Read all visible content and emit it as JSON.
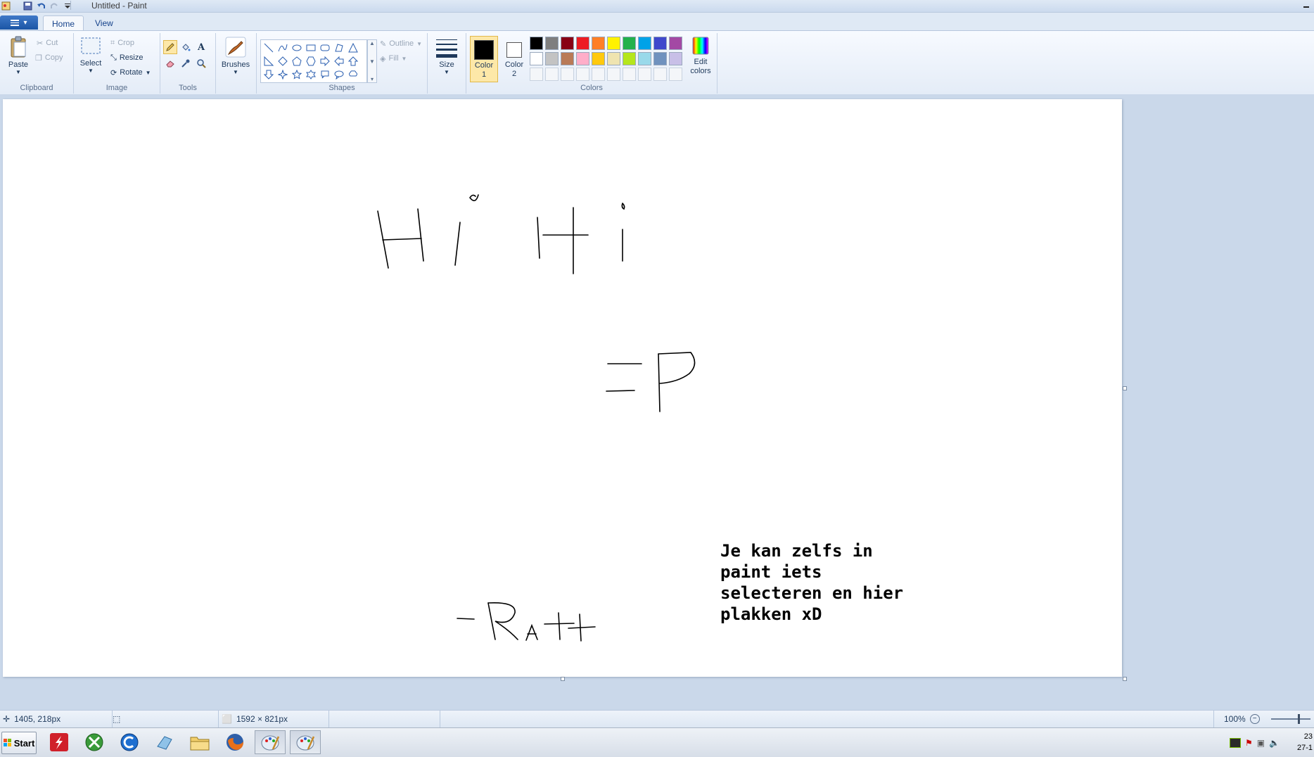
{
  "window": {
    "title": "Untitled - Paint"
  },
  "tabs": [
    {
      "label": "Home",
      "selected": true
    },
    {
      "label": "View",
      "selected": false
    }
  ],
  "ribbon": {
    "clipboard": {
      "paste": "Paste",
      "cut": "Cut",
      "copy": "Copy",
      "group": "Clipboard"
    },
    "image": {
      "select": "Select",
      "crop": "Crop",
      "resize": "Resize",
      "rotate": "Rotate",
      "group": "Image"
    },
    "tools": {
      "group": "Tools"
    },
    "brushes": {
      "label": "Brushes"
    },
    "shapes": {
      "outline": "Outline",
      "fill": "Fill",
      "group": "Shapes"
    },
    "size": {
      "label": "Size"
    },
    "colors": {
      "color1": "Color 1",
      "color2": "Color 2",
      "edit": "Edit colors",
      "group": "Colors",
      "color1_value": "#000000",
      "color2_value": "#ffffff",
      "row1": [
        "#000000",
        "#7f7f7f",
        "#880015",
        "#ed1c24",
        "#ff7f27",
        "#fff200",
        "#22b14c",
        "#00a2e8",
        "#3f48cc",
        "#a349a4"
      ],
      "row2": [
        "#ffffff",
        "#c3c3c3",
        "#b97a57",
        "#ffaec9",
        "#ffc90e",
        "#efe4b0",
        "#b5e61d",
        "#99d9ea",
        "#7092be",
        "#c8bfe7"
      ]
    }
  },
  "canvas": {
    "text_block": "Je kan zelfs in\npaint iets\nselecteren en hier\nplakken xD",
    "drawings": [
      "Hi Hi",
      "=P",
      "-Ratt"
    ]
  },
  "status": {
    "cursor_position": "1405, 218px",
    "image_size": "1592 × 821px",
    "zoom": "100%"
  },
  "taskbar": {
    "start": "Start",
    "clock_time": "23",
    "clock_date": "27-1"
  }
}
